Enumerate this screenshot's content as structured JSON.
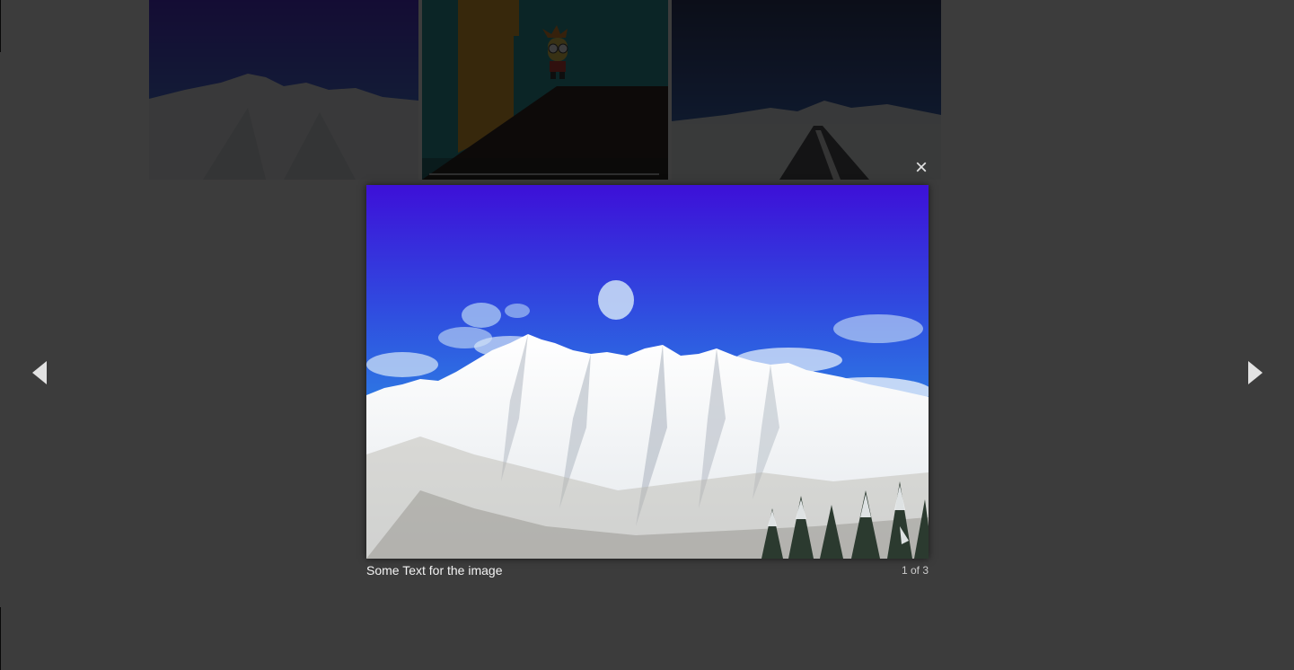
{
  "gallery": {
    "thumbnails": [
      {
        "name": "mountain-thumbnail",
        "kind": "image"
      },
      {
        "name": "video-thumbnail",
        "kind": "video"
      },
      {
        "name": "road-thumbnail",
        "kind": "image"
      }
    ]
  },
  "lightbox": {
    "close_icon": "×",
    "caption": "Some Text for the image",
    "counter": "1 of 3",
    "prev_icon": "arrow-left-icon",
    "next_icon": "arrow-right-icon"
  },
  "colors": {
    "overlay": "#0b0b0b",
    "sky_top": "#3d10d8",
    "sky_bottom": "#2f6fe0",
    "snow": "#f4f6f8",
    "video_bg": "#0c8a93",
    "video_ramp": "#140804",
    "video_panel": "#e39b0f"
  }
}
